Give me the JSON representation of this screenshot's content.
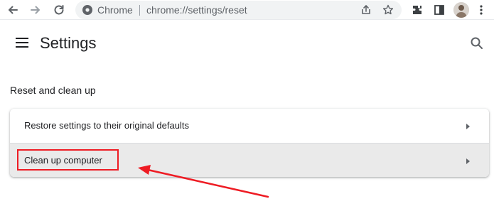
{
  "toolbar": {
    "site_name": "Chrome",
    "url": "chrome://settings/reset",
    "icons": [
      "back-icon",
      "forward-icon",
      "reload-icon",
      "site-info-icon",
      "share-icon",
      "star-icon",
      "extensions-icon",
      "side-panel-icon",
      "avatar",
      "more-icon"
    ]
  },
  "header": {
    "title": "Settings"
  },
  "section": {
    "title": "Reset and clean up",
    "items": [
      {
        "label": "Restore settings to their original defaults"
      },
      {
        "label": "Clean up computer"
      }
    ]
  },
  "colors": {
    "annotation": "#ee1c24",
    "highlighted_row": "#eaeaea",
    "omnibox": "#f1f3f4"
  }
}
